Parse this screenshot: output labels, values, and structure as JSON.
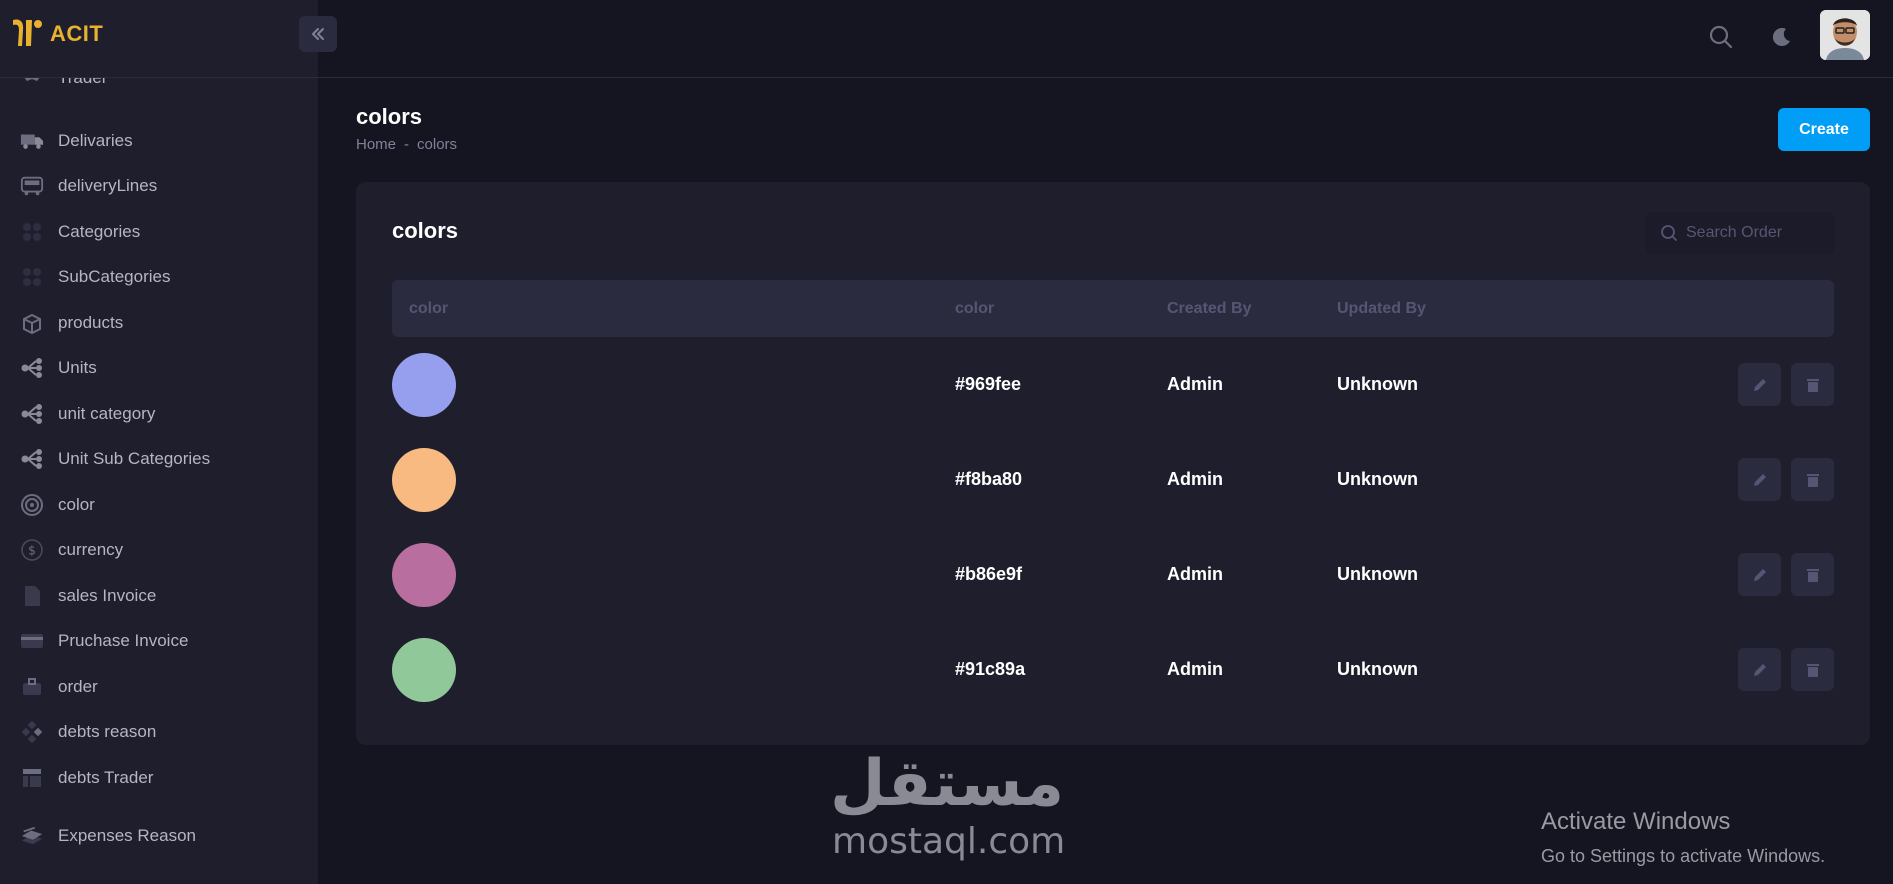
{
  "app": {
    "logo_text": "ACIT"
  },
  "sidebar": {
    "items": [
      {
        "label": "Trader",
        "icon": "handshake-icon"
      },
      {
        "label": "Delivaries",
        "icon": "truck-icon"
      },
      {
        "label": "deliveryLines",
        "icon": "bus-icon"
      },
      {
        "label": "Categories",
        "icon": "grid-icon"
      },
      {
        "label": "SubCategories",
        "icon": "grid-icon"
      },
      {
        "label": "products",
        "icon": "boxes-icon"
      },
      {
        "label": "Units",
        "icon": "hierarchy-icon"
      },
      {
        "label": "unit category",
        "icon": "hierarchy-icon"
      },
      {
        "label": "Unit Sub Categories",
        "icon": "hierarchy-icon"
      },
      {
        "label": "color",
        "icon": "palette-icon"
      },
      {
        "label": "currency",
        "icon": "dollar-icon"
      },
      {
        "label": "sales Invoice",
        "icon": "file-icon"
      },
      {
        "label": "Pruchase Invoice",
        "icon": "card-icon"
      },
      {
        "label": "order",
        "icon": "briefcase-icon"
      },
      {
        "label": "debts reason",
        "icon": "diamond-icon"
      },
      {
        "label": "debts Trader",
        "icon": "layout-icon"
      },
      {
        "label": "Expenses Reason",
        "icon": "stack-icon"
      }
    ]
  },
  "page": {
    "title": "colors",
    "breadcrumb": {
      "home": "Home",
      "sep": "-",
      "current": "colors"
    },
    "create_label": "Create"
  },
  "card": {
    "title": "colors",
    "search_placeholder": "Search Order",
    "columns": [
      "color",
      "color",
      "Created By",
      "Updated By"
    ],
    "rows": [
      {
        "swatch": "#969fee",
        "hex": "#969fee",
        "created_by": "Admin",
        "updated_by": "Unknown"
      },
      {
        "swatch": "#f8ba80",
        "hex": "#f8ba80",
        "created_by": "Admin",
        "updated_by": "Unknown"
      },
      {
        "swatch": "#b86e9f",
        "hex": "#b86e9f",
        "created_by": "Admin",
        "updated_by": "Unknown"
      },
      {
        "swatch": "#91c89a",
        "hex": "#91c89a",
        "created_by": "Admin",
        "updated_by": "Unknown"
      }
    ]
  },
  "watermark": {
    "arabic": "مستقل",
    "latin": "mostaql.com"
  },
  "os_notice": {
    "line1": "Activate Windows",
    "line2": "Go to Settings to activate Windows."
  },
  "colors": {
    "accent": "#009ef7",
    "logo": "#e8b22f",
    "background": "#151521",
    "panel": "#1e1e2d"
  }
}
